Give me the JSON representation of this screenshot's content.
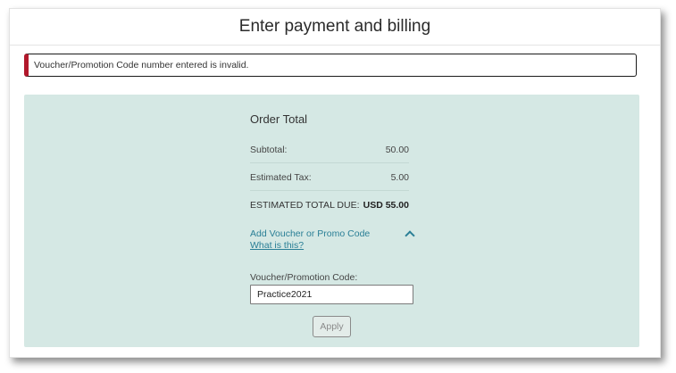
{
  "page": {
    "title": "Enter payment and billing"
  },
  "alert": {
    "message": "Voucher/Promotion Code number entered is invalid.",
    "accent_color": "#b2182b"
  },
  "order": {
    "title": "Order Total",
    "subtotal_label": "Subtotal:",
    "subtotal_value": "50.00",
    "tax_label": "Estimated Tax:",
    "tax_value": "5.00",
    "total_label": "ESTIMATED TOTAL DUE:",
    "total_value": "USD 55.00"
  },
  "voucher": {
    "toggle_label": "Add Voucher or Promo Code",
    "toggle_icon": "chevron-up-icon",
    "help_link": "What is this?",
    "field_label": "Voucher/Promotion Code:",
    "field_value": "Practice2021",
    "apply_label": "Apply"
  },
  "colors": {
    "panel_background": "#d5e8e4",
    "link": "#2a7f96"
  }
}
